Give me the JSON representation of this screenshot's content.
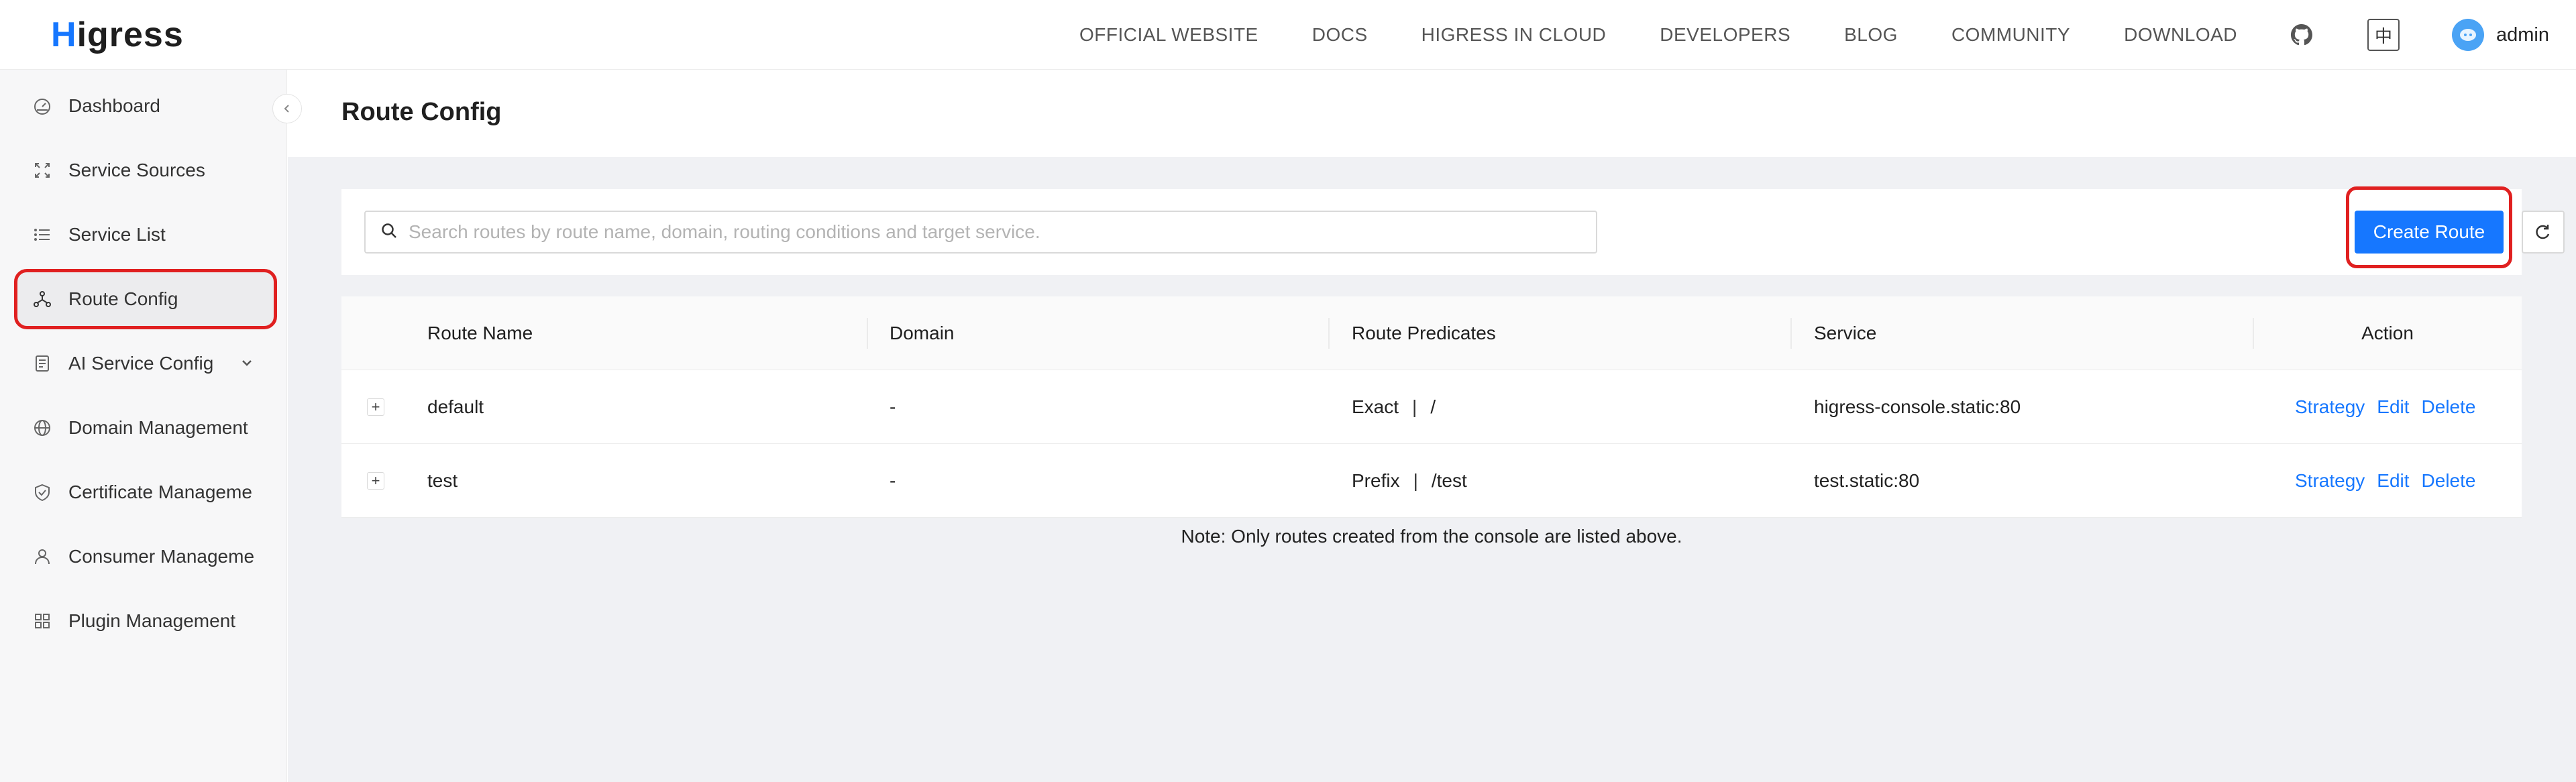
{
  "app": {
    "logo_first": "H",
    "logo_rest": "igress"
  },
  "topnav": {
    "links": [
      "OFFICIAL WEBSITE",
      "DOCS",
      "HIGRESS IN CLOUD",
      "DEVELOPERS",
      "BLOG",
      "COMMUNITY",
      "DOWNLOAD"
    ],
    "lang_label": "中",
    "username": "admin"
  },
  "sidebar": {
    "items": [
      {
        "label": "Dashboard",
        "icon": "dashboard-icon"
      },
      {
        "label": "Service Sources",
        "icon": "service-sources-icon"
      },
      {
        "label": "Service List",
        "icon": "list-icon"
      },
      {
        "label": "Route Config",
        "icon": "route-icon",
        "active": true
      },
      {
        "label": "AI Service Config",
        "icon": "ai-service-icon"
      },
      {
        "label": "Domain Management",
        "icon": "globe-icon"
      },
      {
        "label": "Certificate Manageme",
        "icon": "shield-icon"
      },
      {
        "label": "Consumer Manageme",
        "icon": "user-icon"
      },
      {
        "label": "Plugin Management",
        "icon": "plugin-icon"
      }
    ]
  },
  "page": {
    "title": "Route Config"
  },
  "toolbar": {
    "search_placeholder": "Search routes by route name, domain, routing conditions and target service.",
    "create_label": "Create Route"
  },
  "table": {
    "headers": [
      "Route Name",
      "Domain",
      "Route Predicates",
      "Service",
      "Action"
    ],
    "rows": [
      {
        "name": "default",
        "domain": "-",
        "predicate_type": "Exact",
        "predicate_sep": "|",
        "predicate_path": "/",
        "service": "higress-console.static:80"
      },
      {
        "name": "test",
        "domain": "-",
        "predicate_type": "Prefix",
        "predicate_sep": "|",
        "predicate_path": "/test",
        "service": "test.static:80"
      }
    ],
    "actions": [
      "Strategy",
      "Edit",
      "Delete"
    ],
    "note": "Note: Only routes created from the console are listed above."
  },
  "colors": {
    "accent": "#1677ff",
    "highlight": "#e02020"
  }
}
